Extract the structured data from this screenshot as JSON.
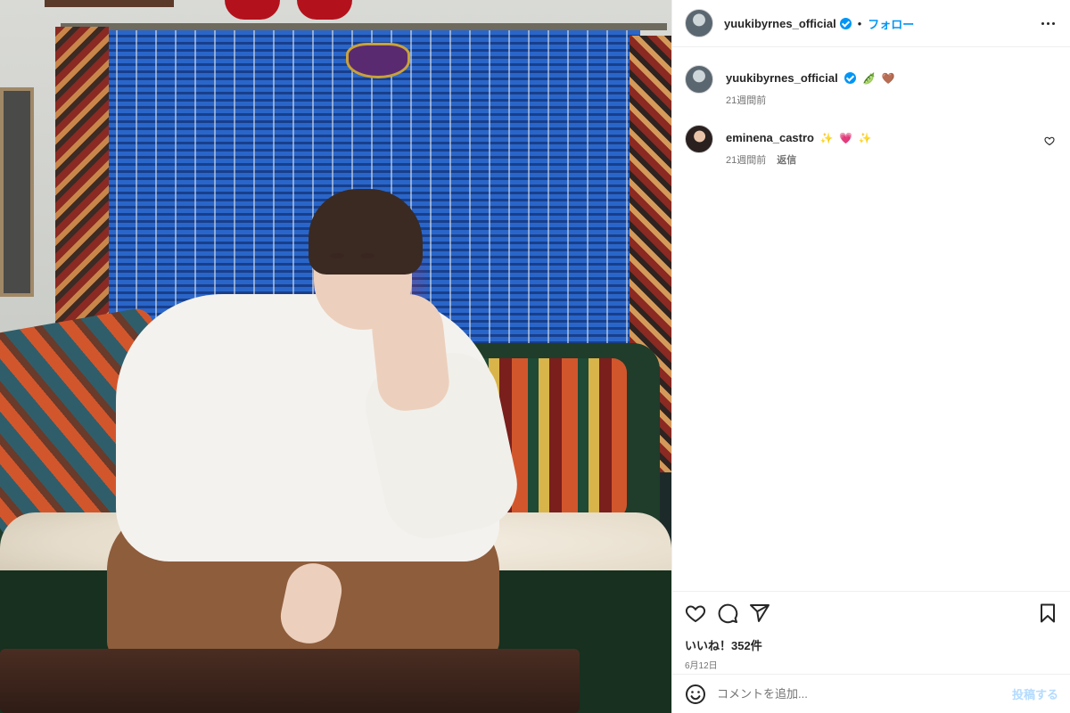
{
  "post": {
    "photo_alt": "photo"
  },
  "header": {
    "username": "yuukibyrnes_official",
    "separator": "•",
    "follow_label": "フォロー"
  },
  "caption": {
    "username": "yuukibyrnes_official",
    "emoji_1": "🫛",
    "emoji_2": "🤎",
    "time": "21週間前"
  },
  "comments": [
    {
      "username": "eminena_castro",
      "emoji_1": "✨",
      "emoji_2": "💗",
      "emoji_3": "✨",
      "time": "21週間前",
      "reply_label": "返信"
    }
  ],
  "stats": {
    "likes": "いいね！352件",
    "date": "6月12日"
  },
  "composer": {
    "placeholder": "コメントを追加...",
    "post_label": "投稿する"
  },
  "icons": {
    "verified": "verified-badge-icon",
    "more": "more-options-icon",
    "like": "heart-outline-icon",
    "comment": "comment-bubble-icon",
    "share": "send-icon",
    "save": "bookmark-icon",
    "emoji": "smiley-icon"
  },
  "colors": {
    "accent": "#0095f6",
    "post_disabled": "#b3dbff",
    "muted": "#737373"
  }
}
